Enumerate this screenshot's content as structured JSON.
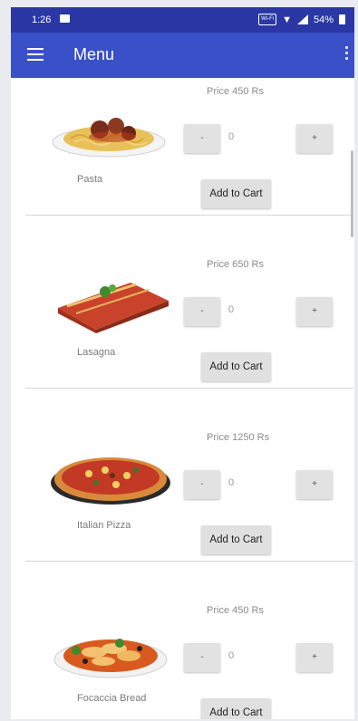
{
  "status_bar": {
    "time": "1:26",
    "battery": "54%",
    "wifi_call": "Wi-Fi"
  },
  "app_bar": {
    "title": "Menu"
  },
  "colors": {
    "status_bar": "#2a37a4",
    "app_bar": "#3a50c9",
    "button_bg": "#e0e0e0"
  },
  "items": [
    {
      "name": "Pasta",
      "price": "Price 450 Rs",
      "qty": "0",
      "minus": "-",
      "plus": "+",
      "add": "Add to Cart",
      "image": "pasta"
    },
    {
      "name": "Lasagna",
      "price": "Price 650 Rs",
      "qty": "0",
      "minus": "-",
      "plus": "+",
      "add": "Add to Cart",
      "image": "lasagna"
    },
    {
      "name": "Italian Pizza",
      "price": "Price 1250 Rs",
      "qty": "0",
      "minus": "-",
      "plus": "+",
      "add": "Add to Cart",
      "image": "pizza"
    },
    {
      "name": "Focaccia Bread",
      "price": "Price 450 Rs",
      "qty": "0",
      "minus": "-",
      "plus": "+",
      "add": "Add to Cart",
      "image": "focaccia"
    }
  ]
}
